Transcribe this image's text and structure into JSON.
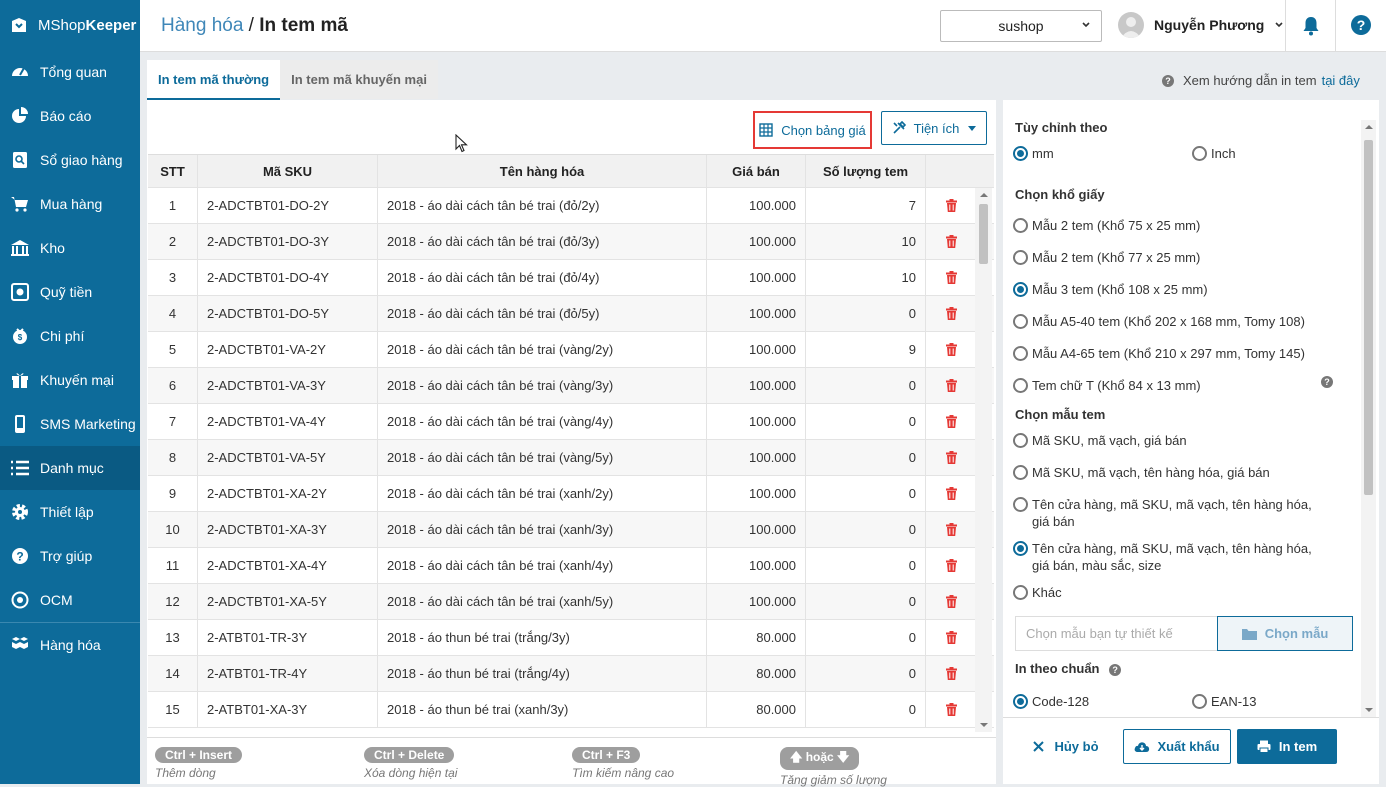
{
  "app": {
    "logo_prefix": "MShop",
    "logo_suffix": "Keeper"
  },
  "sidebar": {
    "items": [
      {
        "label": "Tổng quan",
        "icon": "dashboard-icon"
      },
      {
        "label": "Báo cáo",
        "icon": "pie-chart-icon"
      },
      {
        "label": "Sổ giao hàng",
        "icon": "delivery-book-icon"
      },
      {
        "label": "Mua hàng",
        "icon": "cart-icon"
      },
      {
        "label": "Kho",
        "icon": "warehouse-icon"
      },
      {
        "label": "Quỹ tiền",
        "icon": "money-icon"
      },
      {
        "label": "Chi phí",
        "icon": "expense-icon"
      },
      {
        "label": "Khuyến mại",
        "icon": "gift-icon"
      },
      {
        "label": "SMS Marketing",
        "icon": "phone-icon"
      },
      {
        "label": "Danh mục",
        "icon": "list-icon",
        "active": true
      },
      {
        "label": "Thiết lập",
        "icon": "gear-icon"
      },
      {
        "label": "Trợ giúp",
        "icon": "help-icon"
      },
      {
        "label": "OCM",
        "icon": "ocm-icon"
      },
      {
        "label": "Hàng hóa",
        "icon": "boxes-icon"
      }
    ]
  },
  "header": {
    "breadcrumb_parent": "Hàng hóa",
    "breadcrumb_sep": " / ",
    "breadcrumb_current": "In tem mã",
    "shop": "sushop",
    "user": "Nguyễn Phương"
  },
  "tabs": [
    {
      "label": "In tem mã thường",
      "active": true
    },
    {
      "label": "In tem mã khuyến mại",
      "active": false
    }
  ],
  "guide": {
    "text": "Xem hướng dẫn in tem",
    "link": "tại đây"
  },
  "toolbar": {
    "price_table": "Chọn bảng giá",
    "utilities": "Tiện ích"
  },
  "table": {
    "columns": [
      "STT",
      "Mã SKU",
      "Tên hàng hóa",
      "Giá bán",
      "Số lượng tem"
    ],
    "rows": [
      [
        "1",
        "2-ADCTBT01-DO-2Y",
        "2018 - áo dài cách tân bé trai (đỏ/2y)",
        "100.000",
        "7"
      ],
      [
        "2",
        "2-ADCTBT01-DO-3Y",
        "2018 - áo dài cách tân bé trai (đỏ/3y)",
        "100.000",
        "10"
      ],
      [
        "3",
        "2-ADCTBT01-DO-4Y",
        "2018 - áo dài cách tân bé trai (đỏ/4y)",
        "100.000",
        "10"
      ],
      [
        "4",
        "2-ADCTBT01-DO-5Y",
        "2018 - áo dài cách tân bé trai (đỏ/5y)",
        "100.000",
        "0"
      ],
      [
        "5",
        "2-ADCTBT01-VA-2Y",
        "2018 - áo dài cách tân bé trai (vàng/2y)",
        "100.000",
        "9"
      ],
      [
        "6",
        "2-ADCTBT01-VA-3Y",
        "2018 - áo dài cách tân bé trai (vàng/3y)",
        "100.000",
        "0"
      ],
      [
        "7",
        "2-ADCTBT01-VA-4Y",
        "2018 - áo dài cách tân bé trai (vàng/4y)",
        "100.000",
        "0"
      ],
      [
        "8",
        "2-ADCTBT01-VA-5Y",
        "2018 - áo dài cách tân bé trai (vàng/5y)",
        "100.000",
        "0"
      ],
      [
        "9",
        "2-ADCTBT01-XA-2Y",
        "2018 - áo dài cách tân bé trai (xanh/2y)",
        "100.000",
        "0"
      ],
      [
        "10",
        "2-ADCTBT01-XA-3Y",
        "2018 - áo dài cách tân bé trai (xanh/3y)",
        "100.000",
        "0"
      ],
      [
        "11",
        "2-ADCTBT01-XA-4Y",
        "2018 - áo dài cách tân bé trai (xanh/4y)",
        "100.000",
        "0"
      ],
      [
        "12",
        "2-ADCTBT01-XA-5Y",
        "2018 - áo dài cách tân bé trai (xanh/5y)",
        "100.000",
        "0"
      ],
      [
        "13",
        "2-ATBT01-TR-3Y",
        "2018 - áo thun bé trai (trắng/3y)",
        "80.000",
        "0"
      ],
      [
        "14",
        "2-ATBT01-TR-4Y",
        "2018 - áo thun bé trai (trắng/4y)",
        "80.000",
        "0"
      ],
      [
        "15",
        "2-ATBT01-XA-3Y",
        "2018 - áo thun bé trai (xanh/3y)",
        "80.000",
        "0"
      ]
    ]
  },
  "hints": [
    {
      "key": "Ctrl + Insert",
      "desc": "Thêm dòng"
    },
    {
      "key": "Ctrl + Delete",
      "desc": "Xóa dòng hiện tại"
    },
    {
      "key": "Ctrl + F3",
      "desc": "Tìm kiếm nâng cao"
    },
    {
      "key": "hoặc",
      "desc": "Tăng giảm số lượng"
    }
  ],
  "settings": {
    "unit_title": "Tùy chỉnh theo",
    "units": [
      {
        "label": "mm",
        "checked": true
      },
      {
        "label": "Inch",
        "checked": false
      }
    ],
    "paper_title": "Chọn khổ giấy",
    "papers": [
      {
        "label": "Mẫu 2 tem (Khổ 75 x 25 mm)",
        "checked": false
      },
      {
        "label": "Mẫu 2 tem (Khổ 77 x 25 mm)",
        "checked": false
      },
      {
        "label": "Mẫu 3 tem (Khổ 108 x 25 mm)",
        "checked": true
      },
      {
        "label": "Mẫu A5-40 tem (Khổ 202 x 168 mm, Tomy 108)",
        "checked": false
      },
      {
        "label": "Mẫu A4-65 tem (Khổ 210 x 297 mm, Tomy 145)",
        "checked": false
      },
      {
        "label": "Tem chữ T (Khổ 84 x 13 mm)",
        "checked": false
      }
    ],
    "template_title": "Chọn mẫu tem",
    "templates": [
      {
        "label": "Mã SKU, mã vạch, giá bán",
        "checked": false
      },
      {
        "label": "Mã SKU, mã vạch, tên hàng hóa, giá bán",
        "checked": false
      },
      {
        "label": "Tên cửa hàng, mã SKU, mã vạch, tên hàng hóa, giá bán",
        "checked": false
      },
      {
        "label": "Tên cửa hàng, mã SKU, mã vạch, tên hàng hóa, giá bán, màu sắc, size",
        "checked": true
      },
      {
        "label": "Khác",
        "checked": false
      }
    ],
    "custom_placeholder": "Chọn mẫu bạn tự thiết kế",
    "custom_button": "Chọn mẫu",
    "standard_title": "In theo chuẩn",
    "standards": [
      {
        "label": "Code-128",
        "checked": true
      },
      {
        "label": "EAN-13",
        "checked": false
      }
    ]
  },
  "footer": {
    "cancel": "Hủy bỏ",
    "export": "Xuất khẩu",
    "print": "In tem"
  },
  "colors": {
    "primary": "#0d6b9a",
    "delete": "#e53935",
    "highlight_border": "#e53935"
  }
}
